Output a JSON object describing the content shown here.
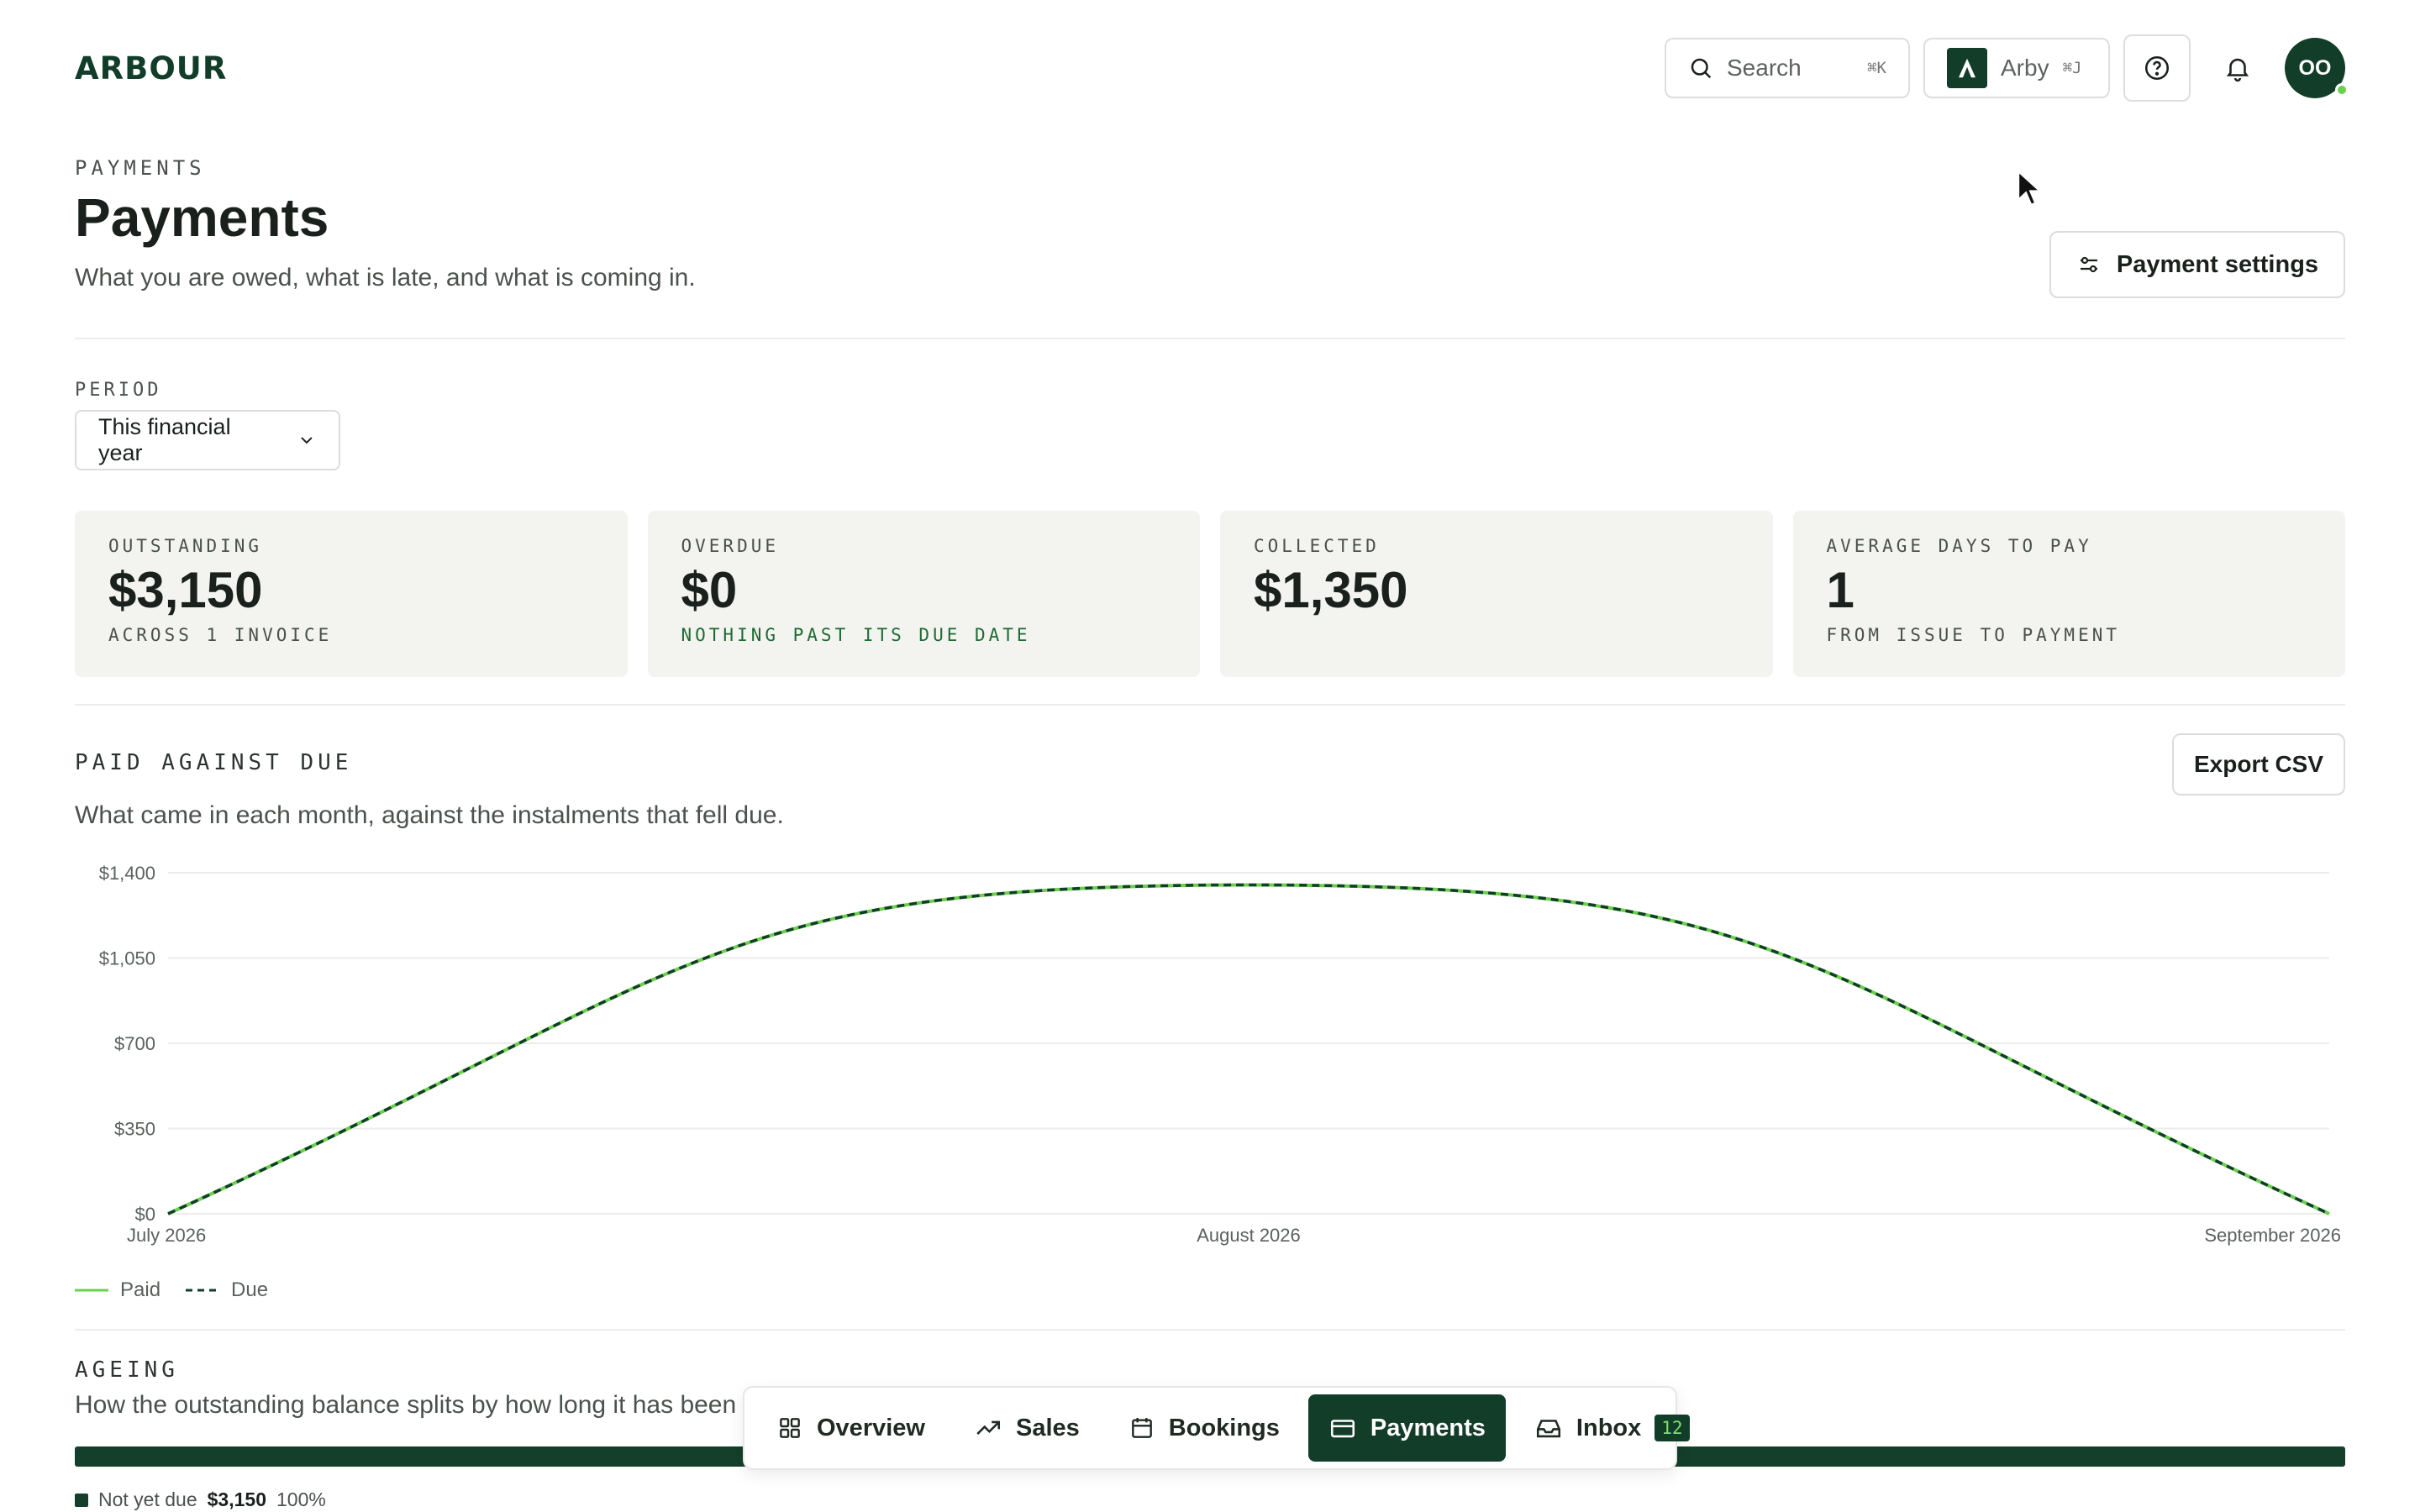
{
  "brand": {
    "logo_text": "ARBOUR"
  },
  "header": {
    "search_label": "Search",
    "search_shortcut": "⌘K",
    "org_name": "Arby",
    "org_shortcut": "⌘J",
    "avatar_initials": "OO"
  },
  "page": {
    "eyebrow": "PAYMENTS",
    "title": "Payments",
    "subtitle": "What you are owed, what is late, and what is coming in.",
    "settings_button": "Payment settings"
  },
  "filters": {
    "period_label": "PERIOD",
    "period_value": "This financial year"
  },
  "stats": [
    {
      "label": "OUTSTANDING",
      "value": "$3,150",
      "note": "ACROSS 1 INVOICE",
      "note_color": "#4a514c"
    },
    {
      "label": "OVERDUE",
      "value": "$0",
      "note": "NOTHING PAST ITS DUE DATE",
      "note_color": "#1f6b33"
    },
    {
      "label": "COLLECTED",
      "value": "$1,350",
      "note": "",
      "note_color": "#4a514c"
    },
    {
      "label": "AVERAGE DAYS TO PAY",
      "value": "1",
      "note": "FROM ISSUE TO PAYMENT",
      "note_color": "#4a514c"
    }
  ],
  "paid_section": {
    "title": "PAID AGAINST DUE",
    "subtitle": "What came in each month, against the instalments that fell due.",
    "export_button": "Export CSV"
  },
  "chart_data": {
    "type": "line",
    "x": [
      "July 2026",
      "August 2026",
      "September 2026"
    ],
    "series": [
      {
        "name": "Paid",
        "values": [
          0,
          1350,
          0
        ],
        "color": "#6ad14c",
        "style": "solid"
      },
      {
        "name": "Due",
        "values": [
          0,
          1350,
          0
        ],
        "color": "#123d29",
        "style": "dashed"
      }
    ],
    "y_ticks": [
      "$0",
      "$350",
      "$700",
      "$1,050",
      "$1,400"
    ],
    "ylim": [
      0,
      1400
    ],
    "grid": true,
    "legend_position": "bottom-left"
  },
  "ageing": {
    "title": "AGEING",
    "subtitle": "How the outstanding balance splits by how long it has been",
    "buckets": [
      {
        "label": "Not yet due",
        "amount": "$3,150",
        "percent": "100%",
        "share": 1.0,
        "color": "#143f2b"
      }
    ]
  },
  "nav": {
    "items": [
      {
        "label": "Overview",
        "icon": "grid-icon"
      },
      {
        "label": "Sales",
        "icon": "trend-icon"
      },
      {
        "label": "Bookings",
        "icon": "calendar-icon"
      },
      {
        "label": "Payments",
        "icon": "card-icon",
        "active": true
      },
      {
        "label": "Inbox",
        "icon": "inbox-icon",
        "badge": "12"
      }
    ]
  },
  "colors": {
    "brand": "#123d29",
    "accent": "#6ad14c",
    "card_bg": "#f3f3f0"
  }
}
